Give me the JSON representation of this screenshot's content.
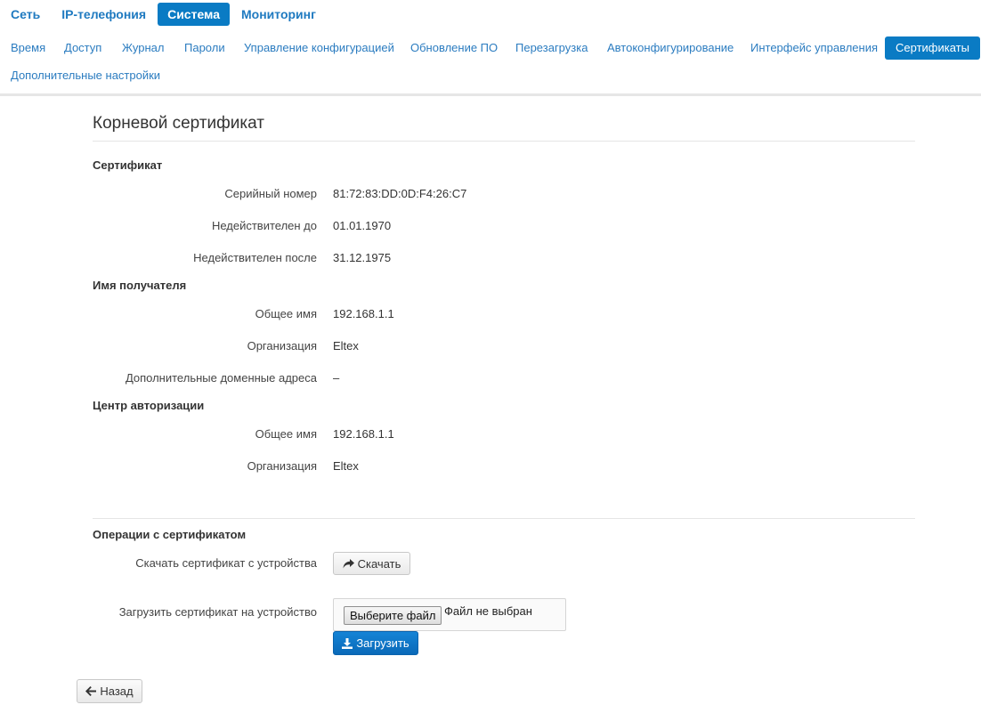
{
  "topnav": {
    "items": [
      {
        "label": "Сеть"
      },
      {
        "label": "IP-телефония"
      },
      {
        "label": "Система"
      },
      {
        "label": "Мониторинг"
      }
    ]
  },
  "subnav": {
    "items": [
      {
        "label": "Время"
      },
      {
        "label": "Доступ"
      },
      {
        "label": "Журнал"
      },
      {
        "label": "Пароли"
      },
      {
        "label": "Управление конфигурацией"
      },
      {
        "label": "Обновление ПО"
      },
      {
        "label": "Перезагрузка"
      },
      {
        "label": "Автоконфигурирование"
      },
      {
        "label": "Интерфейс управления"
      },
      {
        "label": "Сертификаты"
      },
      {
        "label": "Дополнительные настройки"
      }
    ]
  },
  "page": {
    "title": "Корневой сертификат"
  },
  "certificate": {
    "heading": "Сертификат",
    "serial_label": "Серийный номер",
    "serial_value": "81:72:83:DD:0D:F4:26:C7",
    "not_before_label": "Недействителен до",
    "not_before_value": "01.01.1970",
    "not_after_label": "Недействителен после",
    "not_after_value": "31.12.1975"
  },
  "subject": {
    "heading": "Имя получателя",
    "cn_label": "Общее имя",
    "cn_value": "192.168.1.1",
    "org_label": "Организация",
    "org_value": "Eltex",
    "san_label": "Дополнительные доменные адреса",
    "san_value": "–"
  },
  "issuer": {
    "heading": "Центр авторизации",
    "cn_label": "Общее имя",
    "cn_value": "192.168.1.1",
    "org_label": "Организация",
    "org_value": "Eltex"
  },
  "operations": {
    "heading": "Операции с сертификатом",
    "download_label": "Скачать сертификат с устройства",
    "download_button": "Скачать",
    "upload_label": "Загрузить сертификат на устройство",
    "choose_file_button": "Выберите файл",
    "file_status": "Файл не выбран",
    "upload_button": "Загрузить"
  },
  "back_button": "Назад",
  "icons": {
    "download": "share-arrow-icon",
    "upload": "upload-icon",
    "back": "arrow-left-icon"
  },
  "colors": {
    "accent": "#0a7bc4",
    "link": "#2b7cc0"
  }
}
